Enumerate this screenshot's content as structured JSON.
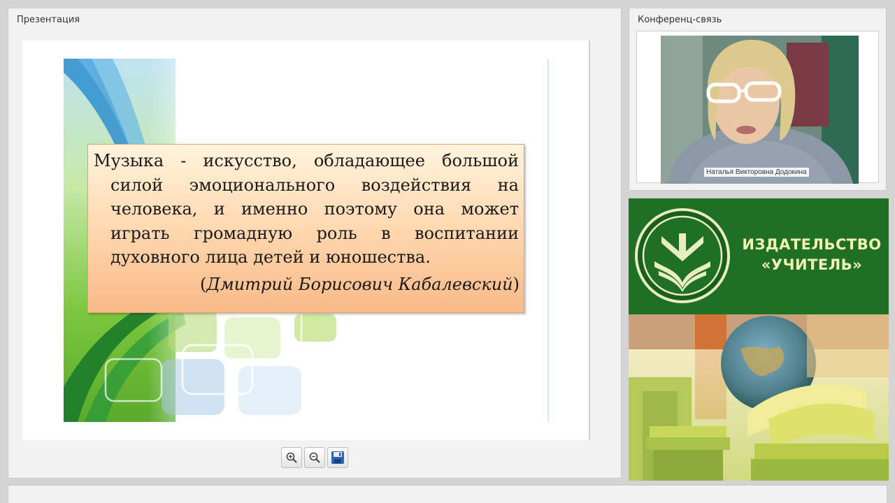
{
  "panels": {
    "presentation_title": "Презентация",
    "conference_title": "Конференц-связь"
  },
  "slide": {
    "quote_lines": [
      "Музыка - искусство, обладающее большой",
      "силой эмоционального воздействия на",
      "человека, и именно поэтому она может",
      "играть громадную роль в воспитании",
      "духовного лица детей и юношества."
    ],
    "author": "Дмитрий Борисович Кабалевский",
    "author_open": "(",
    "author_close": ")"
  },
  "toolbar": {
    "zoom_in_icon": "zoom-in-icon",
    "zoom_out_icon": "zoom-out-icon",
    "save_icon": "floppy-disk-icon"
  },
  "conference": {
    "participant_name": "Наталья Викторовна Додокина"
  },
  "banner": {
    "line1": "ИЗДАТЕЛЬСТВО",
    "line2": "«УЧИТЕЛЬ»",
    "colors": {
      "green": "#1f6f24",
      "text": "#f2f2b6"
    }
  }
}
